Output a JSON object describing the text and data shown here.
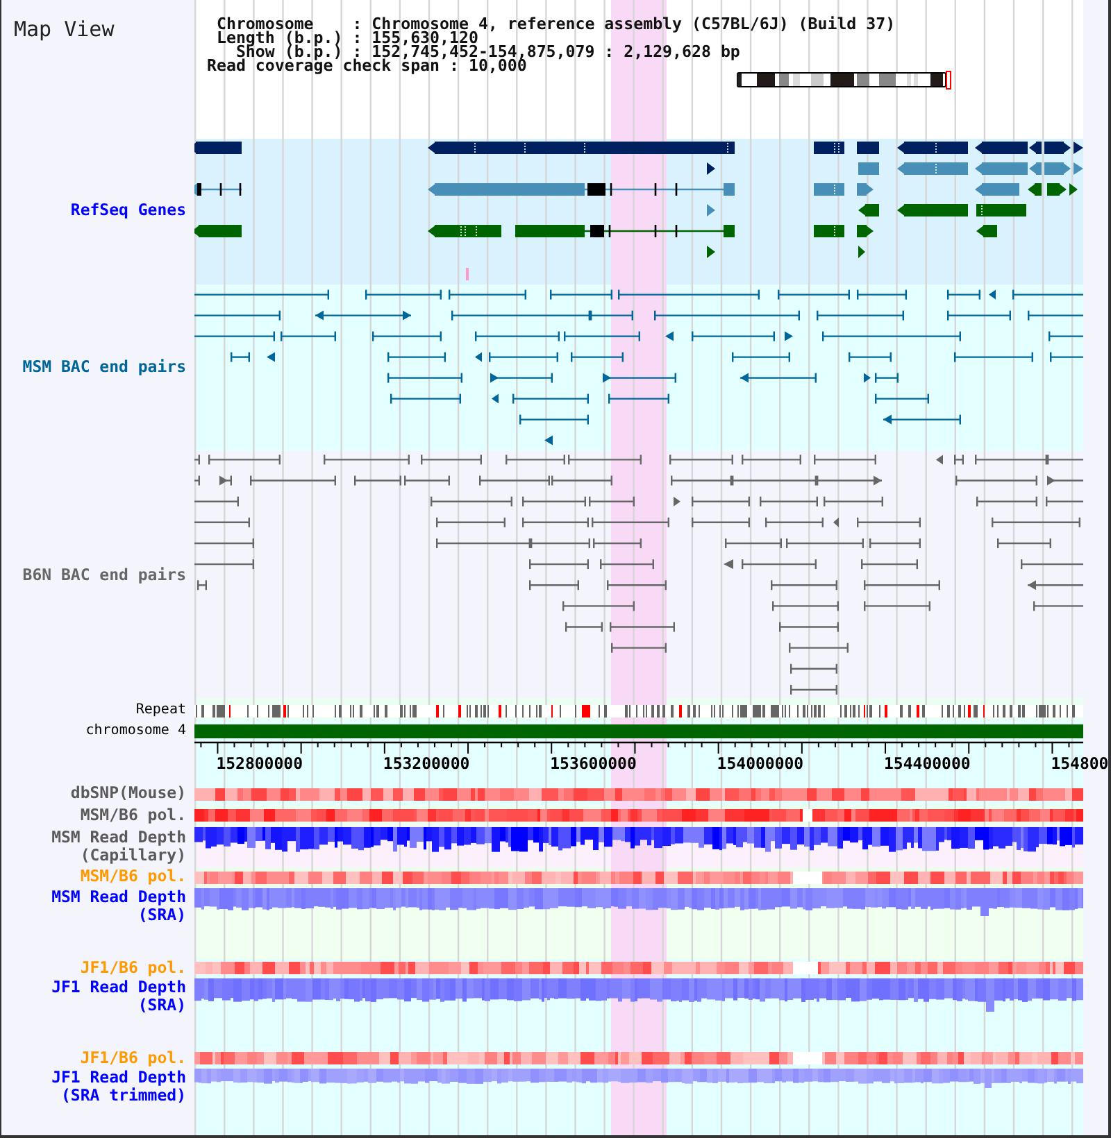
{
  "title": "Map View",
  "info_lines": [
    " Chromosome    : Chromosome 4, reference assembly (C57BL/6J) (Build 37)",
    " Length (b.p.) : 155,630,120",
    "   Show (b.p.) : 152,745,452-154,875,079 : 2,129,628 bp",
    "Read coverage check span : 10,000"
  ],
  "tracks": [
    {
      "kind": "genes",
      "label": "RefSeq Genes",
      "color": "#0000ff"
    },
    {
      "kind": "pairs",
      "label": "MSM BAC end pairs",
      "color": "#006699"
    },
    {
      "kind": "pairs",
      "label": "B6N BAC end pairs",
      "color": "#666666"
    },
    {
      "kind": "repeat",
      "label": "Repeat",
      "color": "#000000"
    },
    {
      "kind": "chromosome",
      "label": "chromosome 4",
      "color": "#000000"
    },
    {
      "kind": "axis",
      "ticks": [
        "152800000",
        "153200000",
        "153600000",
        "154000000",
        "154400000",
        "154800"
      ]
    },
    {
      "kind": "heat",
      "label": "dbSNP(Mouse)",
      "color": "#5a5a5a"
    },
    {
      "kind": "heat",
      "label": "MSM/B6 pol.",
      "color": "#5a5a5a"
    },
    {
      "kind": "depth",
      "label": "MSM Read Depth (Capillary)",
      "color": "#5a5a5a"
    },
    {
      "kind": "heat",
      "label": "MSM/B6 pol.",
      "color": "#ff9900"
    },
    {
      "kind": "depth",
      "label": "MSM Read Depth (SRA)",
      "color": "#0000ff"
    },
    {
      "kind": "heat",
      "label": "JF1/B6 pol.",
      "color": "#ff9900"
    },
    {
      "kind": "depth",
      "label": "JF1 Read Depth (SRA)",
      "color": "#0000ff"
    },
    {
      "kind": "heat",
      "label": "JF1/B6 pol.",
      "color": "#ff9900"
    },
    {
      "kind": "depth",
      "label": "JF1 Read Depth (SRA trimmed)",
      "color": "#0000ff"
    }
  ]
}
